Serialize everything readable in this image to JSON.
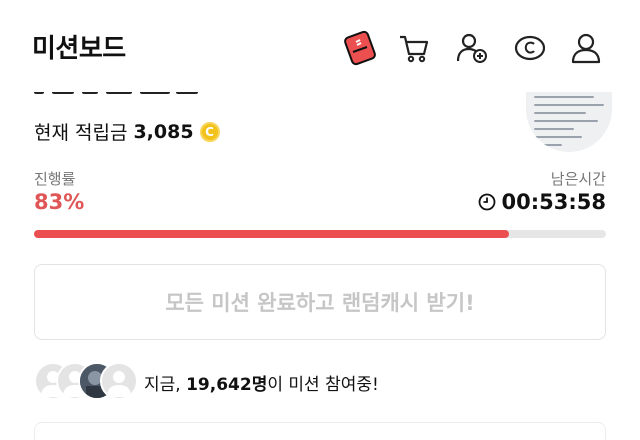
{
  "header": {
    "title": "미션보드"
  },
  "points": {
    "label": "현재 적립금",
    "amount": "3,085",
    "coin_symbol": "C"
  },
  "progress": {
    "label": "진행률",
    "value_text": "83%",
    "value": 0.83
  },
  "timer": {
    "label": "남은시간",
    "value": "00:53:58"
  },
  "cta": {
    "label": "모든 미션 완료하고 랜덤캐시 받기!"
  },
  "participants": {
    "prefix": "지금, ",
    "count": "19,642명",
    "suffix": "이 미션 참여중!"
  },
  "colors": {
    "accent": "#ec4f4f",
    "progress_text": "#e05555",
    "coin": "#f3c21a",
    "disabled_text": "#c6c6c6"
  },
  "icons": [
    "shoe-icon",
    "cart-icon",
    "add-friend-icon",
    "coin-c-icon",
    "profile-icon"
  ]
}
